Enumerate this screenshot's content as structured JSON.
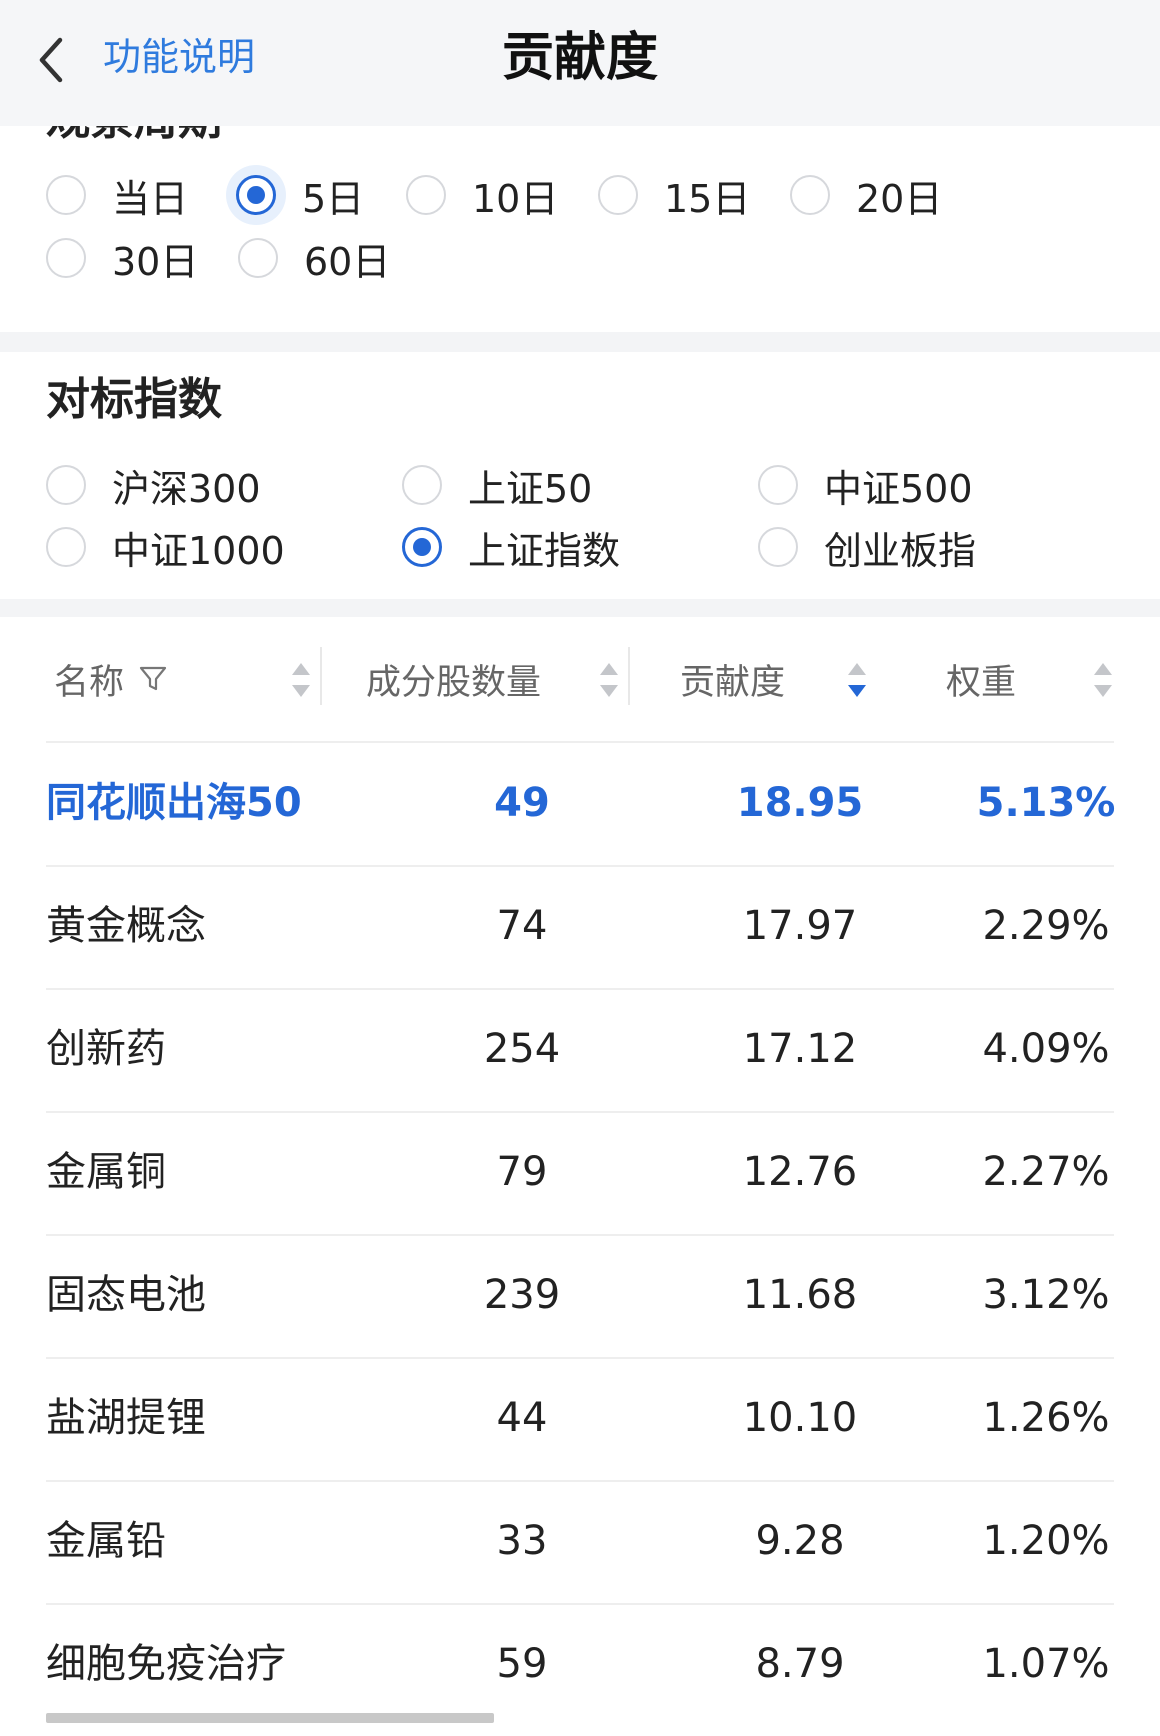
{
  "header": {
    "back_label": "功能说明",
    "title": "贡献度"
  },
  "period": {
    "title": "观察周期",
    "options": [
      "当日",
      "5日",
      "10日",
      "15日",
      "20日",
      "30日",
      "60日"
    ],
    "selected": "5日"
  },
  "index": {
    "title": "对标指数",
    "options": [
      "沪深300",
      "上证50",
      "中证500",
      "中证1000",
      "上证指数",
      "创业板指"
    ],
    "selected": "上证指数"
  },
  "table": {
    "headers": {
      "name": "名称",
      "count": "成分股数量",
      "contribution": "贡献度",
      "weight": "权重"
    },
    "sort": {
      "column": "contribution",
      "direction": "desc"
    },
    "rows": [
      {
        "name": "同花顺出海50",
        "count": "49",
        "contribution": "18.95",
        "weight": "5.13%"
      },
      {
        "name": "黄金概念",
        "count": "74",
        "contribution": "17.97",
        "weight": "2.29%"
      },
      {
        "name": "创新药",
        "count": "254",
        "contribution": "17.12",
        "weight": "4.09%"
      },
      {
        "name": "金属铜",
        "count": "79",
        "contribution": "12.76",
        "weight": "2.27%"
      },
      {
        "name": "固态电池",
        "count": "239",
        "contribution": "11.68",
        "weight": "3.12%"
      },
      {
        "name": "盐湖提锂",
        "count": "44",
        "contribution": "10.10",
        "weight": "1.26%"
      },
      {
        "name": "金属铅",
        "count": "33",
        "contribution": "9.28",
        "weight": "1.20%"
      },
      {
        "name": "细胞免疫治疗",
        "count": "59",
        "contribution": "8.79",
        "weight": "1.07%"
      }
    ]
  },
  "colors": {
    "accent": "#2467d6",
    "link": "#2f7bde",
    "header_bg": "#f5f6f8"
  }
}
